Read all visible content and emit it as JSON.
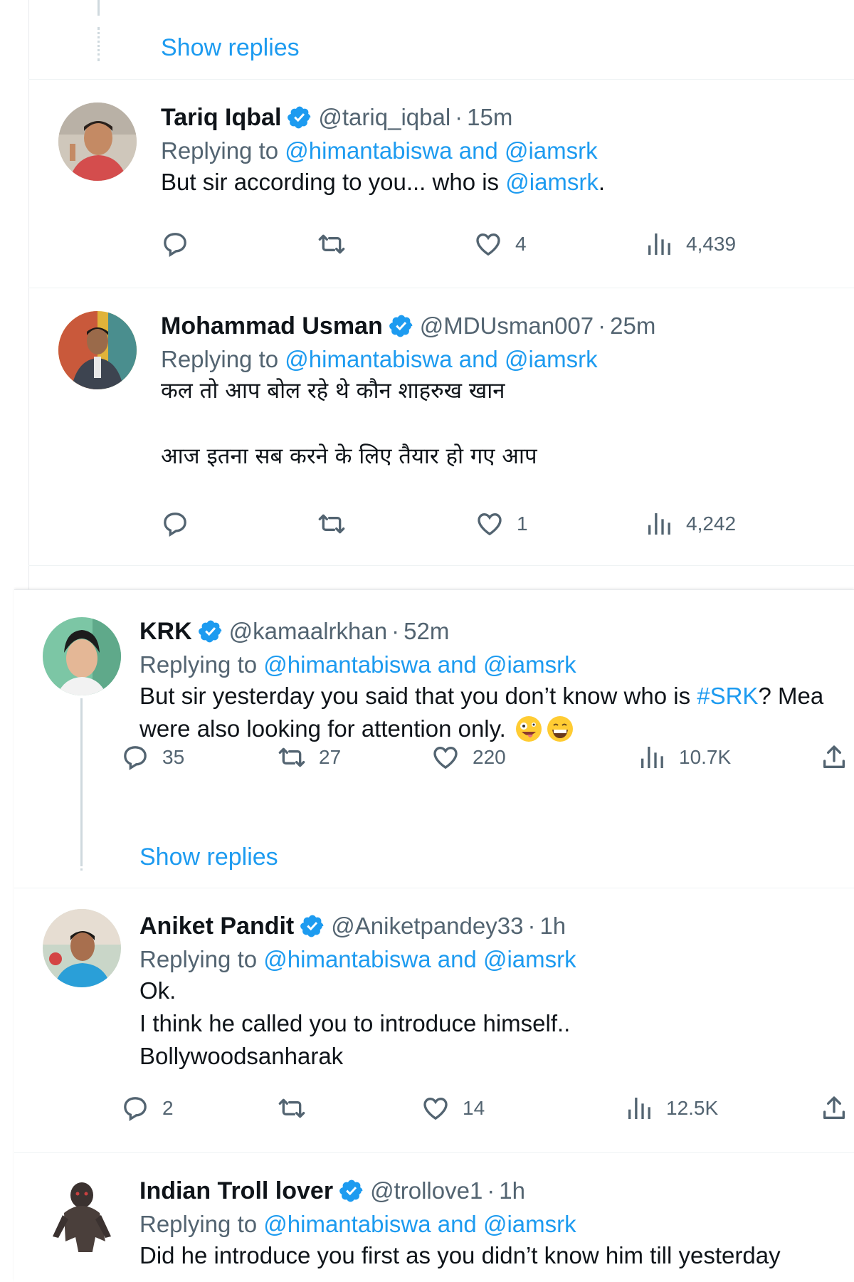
{
  "colors": {
    "accent": "#1d9bf0",
    "muted": "#536471",
    "text": "#0f1419"
  },
  "top_show_replies": "Show replies",
  "tweets": [
    {
      "name": "Tariq Iqbal",
      "handle": "@tariq_iqbal",
      "time": "15m",
      "replying_prefix": "Replying to",
      "replying_to": "@himantabiswa and @iamsrk",
      "text_before": "But sir according to you... who is ",
      "text_mention": "@iamsrk",
      "text_after": ".",
      "replies": "",
      "retweets": "",
      "likes": "4",
      "views": "4,439"
    },
    {
      "name": "Mohammad Usman",
      "handle": "@MDUsman007",
      "time": "25m",
      "replying_prefix": "Replying to",
      "replying_to": "@himantabiswa and @iamsrk",
      "line1": "कल तो आप बोल रहे थे कौन शाहरुख खान",
      "line2": "आज इतना सब करने के लिए तैयार हो गए आप",
      "replies": "",
      "retweets": "",
      "likes": "1",
      "views": "4,242"
    },
    {
      "name": "KRK",
      "handle": "@kamaalrkhan",
      "time": "52m",
      "replying_prefix": "Replying to",
      "replying_to": "@himantabiswa and @iamsrk",
      "text_before": "But sir yesterday you said that you don’t know who is ",
      "text_hashtag": "#SRK",
      "text_after": "? Mea",
      "line2": "were also looking for attention only.",
      "emoji": [
        "zany-face",
        "grinning-face"
      ],
      "replies": "35",
      "retweets": "27",
      "likes": "220",
      "views": "10.7K",
      "show_replies": "Show replies"
    },
    {
      "name": "Aniket Pandit",
      "handle": "@Aniketpandey33",
      "time": "1h",
      "replying_prefix": "Replying to",
      "replying_to": "@himantabiswa and @iamsrk",
      "line1": "Ok.",
      "line2": "I think he called you to introduce himself..",
      "line3": "Bollywoodsanharak",
      "replies": "2",
      "retweets": "",
      "likes": "14",
      "views": "12.5K"
    },
    {
      "name": "Indian Troll lover",
      "handle": "@trollove1",
      "time": "1h",
      "replying_prefix": "Replying to",
      "replying_to": "@himantabiswa and @iamsrk",
      "line1": "Did he introduce you first as you didn’t know him till yesterday"
    }
  ]
}
